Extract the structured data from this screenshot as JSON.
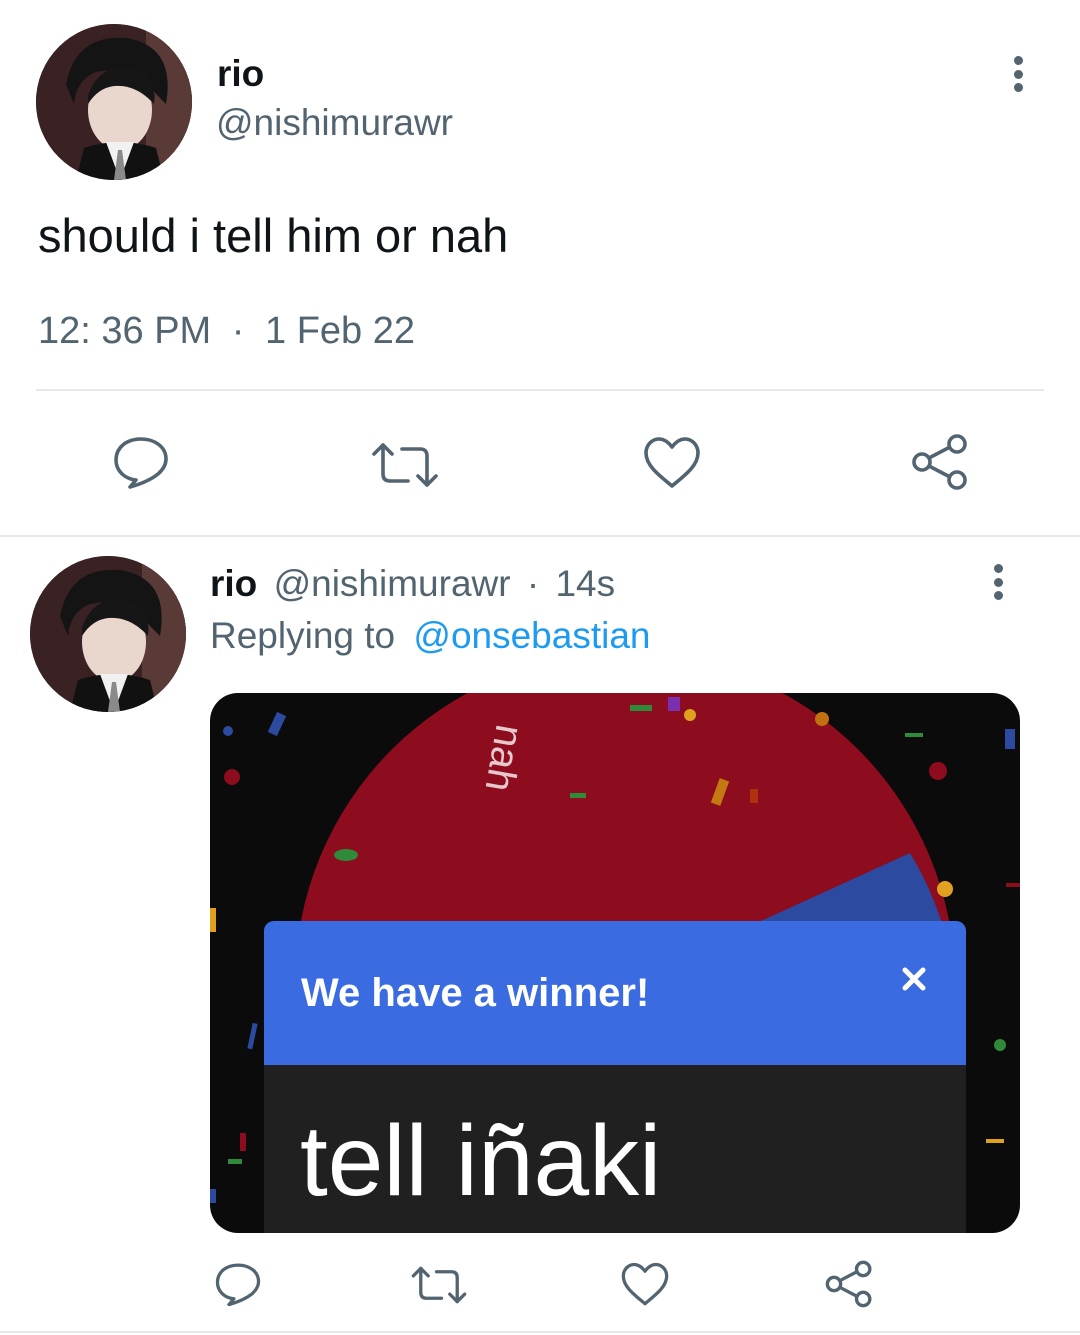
{
  "main_tweet": {
    "display_name": "rio",
    "handle": "@nishimurawr",
    "text": "should i tell him or nah",
    "time": "12: 36 PM",
    "separator": "·",
    "date": "1 Feb 22"
  },
  "reply_tweet": {
    "display_name": "rio",
    "handle": "@nishimurawr",
    "separator": "·",
    "age": "14s",
    "replying_prefix": "Replying to",
    "replying_to": "@onsebastian",
    "media": {
      "wheel_segment_label": "nah",
      "dialog_title": "We have a winner!",
      "winner": "tell iñaki",
      "wheel_red": "#8d0c1e",
      "wheel_blue": "#2b4aa0",
      "dialog_header": "#3a6be0",
      "dialog_body": "#202020"
    }
  },
  "colors": {
    "text": "#0f1419",
    "secondary": "#536471",
    "link": "#1d9bf0",
    "divider": "#e6e9ec"
  },
  "icons": {
    "reply": "reply-icon",
    "retweet": "retweet-icon",
    "like": "heart-icon",
    "share": "share-icon",
    "more": "more-options-icon",
    "close": "close-icon"
  }
}
